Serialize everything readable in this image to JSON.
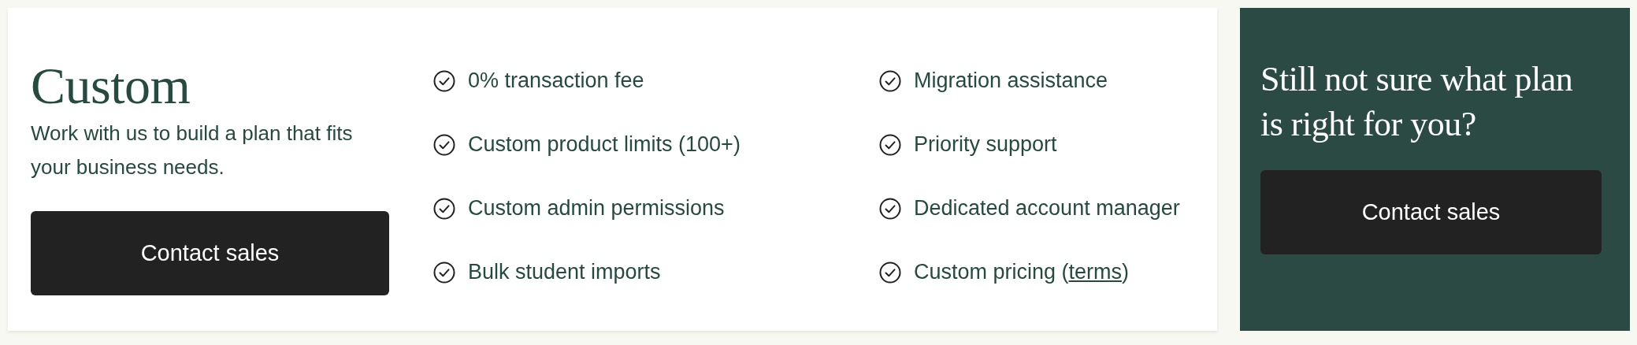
{
  "plan": {
    "title": "Custom",
    "description": "Work with us to build a plan that fits your business needs.",
    "button": "Contact sales"
  },
  "features": [
    {
      "text": "0% transaction fee"
    },
    {
      "text": "Custom product limits (100+)"
    },
    {
      "text": "Custom admin permissions"
    },
    {
      "text": "Bulk student imports"
    },
    {
      "text": "Migration assistance"
    },
    {
      "text": "Priority support"
    },
    {
      "text": "Dedicated account manager"
    },
    {
      "text": "Custom pricing (",
      "link": "terms",
      "after": ")"
    }
  ],
  "help": {
    "title": "Still not sure what plan is right for you?",
    "button": "Contact sales"
  }
}
